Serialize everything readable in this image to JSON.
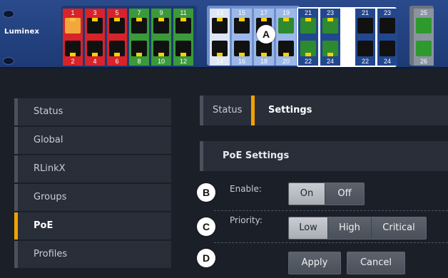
{
  "brand": {
    "name": "Luminex"
  },
  "ports": [
    {
      "top": "1",
      "bottom": "2",
      "color": "#d8232a",
      "topFill": "#f2a73b",
      "topLed": "#f6c23b",
      "botFill": "#111111",
      "botLed": "#f6d200"
    },
    {
      "top": "3",
      "bottom": "4",
      "color": "#d8232a",
      "topFill": "#111111",
      "topLed": "#f6d200",
      "botFill": "#111111",
      "botLed": "#f6d200"
    },
    {
      "top": "5",
      "bottom": "6",
      "color": "#d8232a",
      "topFill": "#111111",
      "topLed": "#f6d200",
      "botFill": "#111111",
      "botLed": "#f6d200"
    },
    {
      "top": "7",
      "bottom": "8",
      "color": "#3a9a3a",
      "topFill": "#111111",
      "topLed": "#f6d200",
      "botFill": "#111111",
      "botLed": "#f6d200"
    },
    {
      "top": "9",
      "bottom": "10",
      "color": "#3a9a3a",
      "topFill": "#111111",
      "topLed": "#f6d200",
      "botFill": "#111111",
      "botLed": "#f6d200"
    },
    {
      "top": "11",
      "bottom": "12",
      "color": "#3a9a3a",
      "topFill": "#111111",
      "topLed": "#f6d200",
      "botFill": "#111111",
      "botLed": "#f6d200"
    },
    {
      "top": "13",
      "bottom": "14",
      "color": "#dfe6f5",
      "topFill": "#111111",
      "topLed": "#f6d200",
      "botFill": "#111111",
      "botLed": "#f6d200"
    },
    {
      "top": "15",
      "bottom": "16",
      "color": "#9cb8e8",
      "topFill": "#111111",
      "topLed": "#f6d200",
      "botFill": "#111111",
      "botLed": "#f6d200"
    },
    {
      "top": "17",
      "bottom": "18",
      "color": "#9cb8e8",
      "topFill": "#111111",
      "topLed": "#f6d200",
      "botFill": "#111111",
      "botLed": "#f6d200"
    },
    {
      "top": "19",
      "bottom": "20",
      "color": "#9cb8e8",
      "topFill": "#2e8a2e",
      "topLed": "#f6d200",
      "botFill": "#111111",
      "botLed": "#f6d200"
    },
    {
      "top": "21",
      "bottom": "22",
      "color": "#23478f",
      "topFill": "#2e8a2e",
      "topLed": "#f6d200",
      "botFill": "#2e8a2e",
      "botLed": "#f6d200"
    },
    {
      "top": "23",
      "bottom": "24",
      "color": "#23478f",
      "topFill": "#2e8a2e",
      "topLed": "#f6d200",
      "botFill": "#2e8a2e",
      "botLed": "#f6d200"
    },
    {
      "top": "21",
      "bottom": "22",
      "color": "#23478f",
      "topFill": "#111111",
      "topLed": "#111111",
      "botFill": "#111111",
      "botLed": "#111111"
    },
    {
      "top": "23",
      "bottom": "24",
      "color": "#23478f",
      "topFill": "#111111",
      "topLed": "#111111",
      "botFill": "#111111",
      "botLed": "#111111"
    },
    {
      "top": "25",
      "bottom": "26",
      "color": "#8c93a0",
      "topFill": "#2e9a2e",
      "topLed": "#2e9a2e",
      "botFill": "#2e9a2e",
      "botLed": "#2e9a2e"
    }
  ],
  "badges": {
    "a": "A",
    "b": "B",
    "c": "C",
    "d": "D"
  },
  "sidebar": {
    "items": [
      {
        "label": "Status"
      },
      {
        "label": "Global"
      },
      {
        "label": "RLinkX"
      },
      {
        "label": "Groups"
      },
      {
        "label": "PoE"
      },
      {
        "label": "Profiles"
      }
    ],
    "active_index": 4
  },
  "tabs": {
    "status": "Status",
    "settings": "Settings"
  },
  "panel": {
    "title": "PoE Settings",
    "enable": {
      "label": "Enable:",
      "on": "On",
      "off": "Off",
      "selected": "on"
    },
    "priority": {
      "label": "Priority:",
      "low": "Low",
      "high": "High",
      "critical": "Critical",
      "selected": "low"
    },
    "apply": "Apply",
    "cancel": "Cancel"
  },
  "colors": {
    "accent": "#f2a100",
    "header": "#23478f",
    "background": "#1b1f27"
  }
}
